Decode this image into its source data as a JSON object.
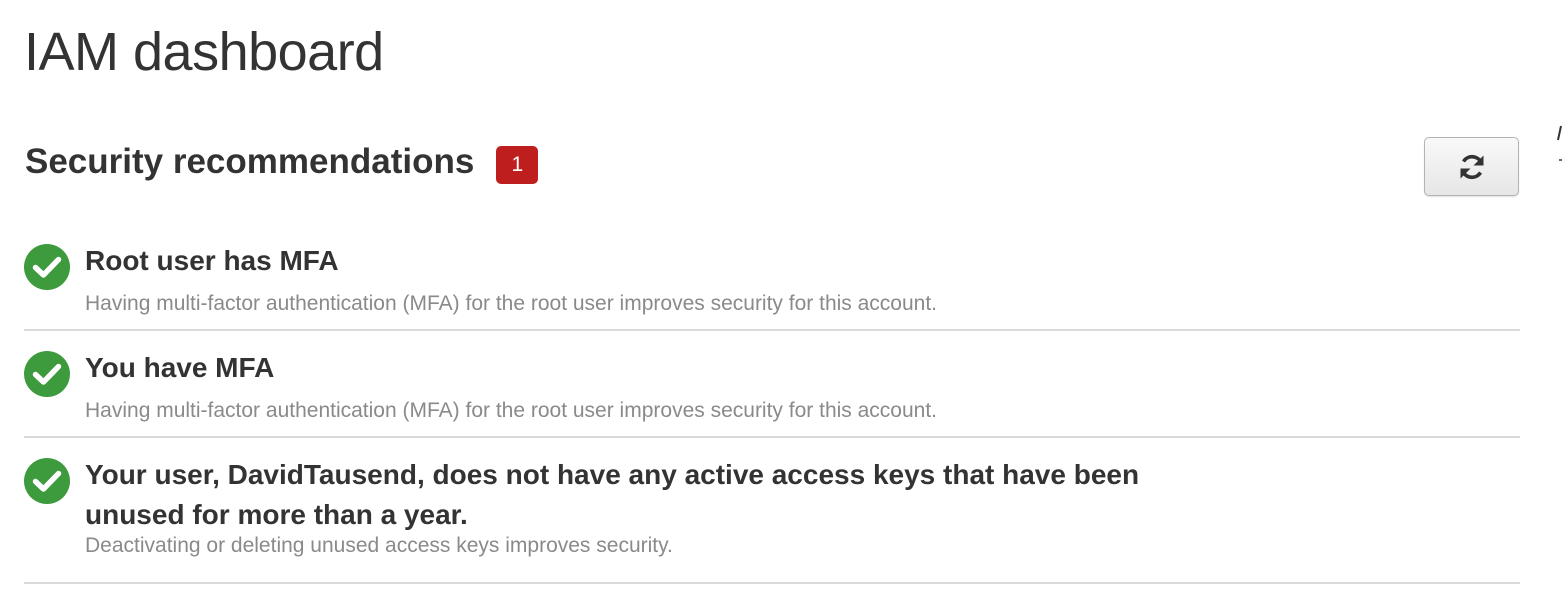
{
  "page": {
    "title": "IAM dashboard"
  },
  "security": {
    "heading": "Security recommendations",
    "badge_count": "1",
    "refresh_icon": "refresh-icon",
    "items": [
      {
        "status_icon": "check-circle-icon",
        "title": "Root user has MFA",
        "description": "Having multi-factor authentication (MFA) for the root user improves security for this account."
      },
      {
        "status_icon": "check-circle-icon",
        "title": "You have MFA",
        "description": "Having multi-factor authentication (MFA) for the root user improves security for this account."
      },
      {
        "status_icon": "check-circle-icon",
        "title": "Your user, DavidTausend, does not have any active access keys that have been unused for more than a year.",
        "description": "Deactivating or deleting unused access keys improves security."
      }
    ]
  },
  "colors": {
    "success_green": "#3d9a3d",
    "badge_red": "#bf1e1e",
    "divider": "#d9d9d9"
  }
}
